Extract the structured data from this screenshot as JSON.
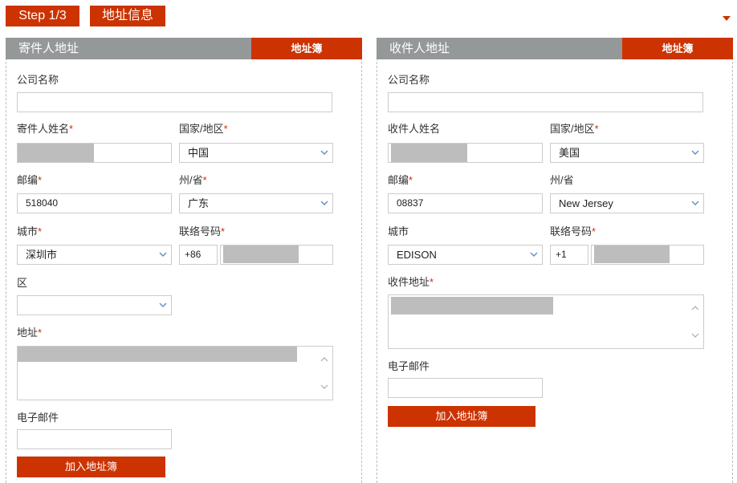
{
  "header": {
    "step": "Step 1/3",
    "title": "地址信息",
    "accent_color": "#cc3300",
    "collapse_icon": "caret-down-icon"
  },
  "sender": {
    "title": "寄件人地址",
    "address_book_tab": "地址簿",
    "company_label": "公司名称",
    "company_value": "",
    "name_label": "寄件人姓名",
    "name_required": "*",
    "country_label": "国家/地区",
    "country_required": "*",
    "country_value": "中国",
    "postcode_label": "邮编",
    "postcode_required": "*",
    "postcode_value": "518040",
    "state_label": "州/省",
    "state_required": "*",
    "state_value": "广东",
    "city_label": "城市",
    "city_required": "*",
    "city_value": "深圳市",
    "phone_label": "联络号码",
    "phone_required": "*",
    "phone_code": "+86",
    "district_label": "区",
    "district_value": "",
    "address_label": "地址",
    "address_required": "*",
    "email_label": "电子邮件",
    "email_value": "",
    "add_button": "加入地址簿"
  },
  "receiver": {
    "title": "收件人地址",
    "address_book_tab": "地址簿",
    "company_label": "公司名称",
    "company_value": "",
    "name_label": "收件人姓名",
    "country_label": "国家/地区",
    "country_required": "*",
    "country_value": "美国",
    "postcode_label": "邮编",
    "postcode_required": "*",
    "postcode_value": "08837",
    "state_label": "州/省",
    "state_value": "New Jersey",
    "city_label": "城市",
    "city_value": "EDISON",
    "phone_label": "联络号码",
    "phone_required": "*",
    "phone_code": "+1",
    "address_label": "收件地址",
    "address_required": "*",
    "email_label": "电子邮件",
    "email_value": "",
    "add_button": "加入地址簿"
  }
}
